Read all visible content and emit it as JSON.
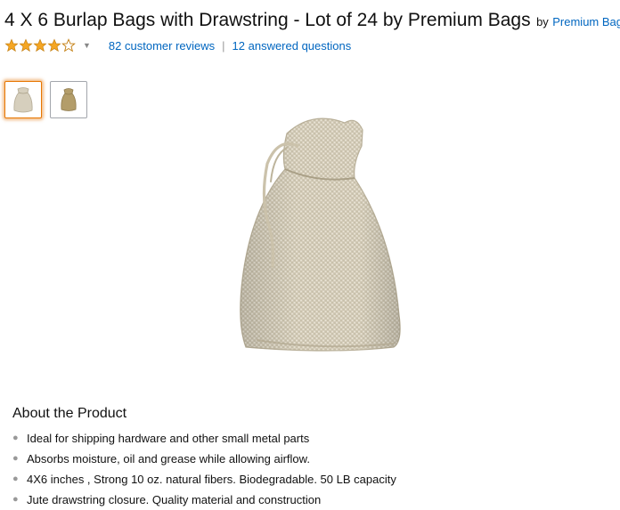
{
  "product": {
    "title": "4 X 6 Burlap Bags with Drawstring - Lot of 24 by Premium Bags",
    "by_label": "by",
    "brand": "Premium Bags"
  },
  "rating": {
    "stars": 4,
    "max_stars": 5,
    "reviews_link": "82 customer reviews",
    "separator": "|",
    "questions_link": "12 answered questions"
  },
  "colors": {
    "link": "#0066c0",
    "star": "#f5a623",
    "selected_thumb": "#e77600",
    "burlap": "#d8d1bf"
  },
  "icons": [
    "star-icon",
    "chevron-down-icon"
  ],
  "gallery": {
    "thumbnails": [
      "burlap-bag-front",
      "burlap-bag-tan"
    ],
    "selected_index": 0
  },
  "about": {
    "title": "About the Product",
    "bullets": [
      "Ideal for shipping hardware and other small metal parts",
      "Absorbs moisture, oil and grease while allowing airflow.",
      "4X6 inches , Strong 10 oz. natural fibers. Biodegradable. 50 LB capacity",
      "Jute drawstring closure. Quality material and construction"
    ]
  }
}
